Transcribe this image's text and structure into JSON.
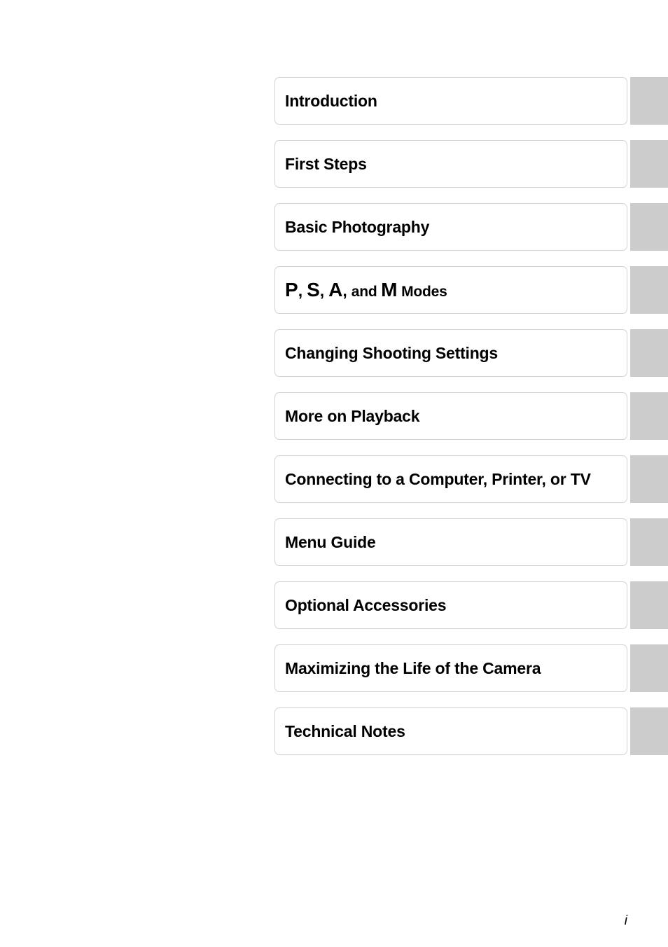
{
  "page": {
    "folio": "i",
    "tab_color": "#cccccc",
    "card_border_color": "#d2d2d2",
    "background_color": "#ffffff",
    "text_color": "#000000"
  },
  "chapter_index": {
    "items": [
      {
        "label": "Introduction",
        "styled": false
      },
      {
        "label": "First Steps",
        "styled": false
      },
      {
        "label": "Basic Photography",
        "styled": false
      },
      {
        "label": "P, S, A, and M Modes",
        "styled": true,
        "parts": [
          {
            "text": "P",
            "style": "mode-glyph"
          },
          {
            "text": ", ",
            "style": "mode-sep"
          },
          {
            "text": "S",
            "style": "mode-glyph"
          },
          {
            "text": ", ",
            "style": "mode-sep"
          },
          {
            "text": "A",
            "style": "mode-glyph"
          },
          {
            "text": ", ",
            "style": "mode-sep"
          },
          {
            "text": "and ",
            "style": "mode-word"
          },
          {
            "text": "M",
            "style": "mode-glyph"
          },
          {
            "text": " Modes",
            "style": "mode-word"
          }
        ]
      },
      {
        "label": "Changing Shooting Settings",
        "styled": false
      },
      {
        "label": "More on Playback",
        "styled": false
      },
      {
        "label": "Connecting to a Computer, Printer, or TV",
        "styled": false
      },
      {
        "label": "Menu Guide",
        "styled": false
      },
      {
        "label": "Optional Accessories",
        "styled": false
      },
      {
        "label": "Maximizing the Life of the Camera",
        "styled": false
      },
      {
        "label": "Technical Notes",
        "styled": false
      }
    ]
  }
}
